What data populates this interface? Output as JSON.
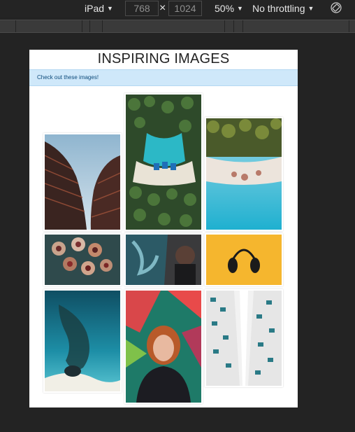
{
  "devtools": {
    "device": "iPad",
    "width": "768",
    "height": "1024",
    "separator": "×",
    "zoom": "50%",
    "throttling": "No throttling",
    "icons": {
      "rotate": "rotate-icon",
      "dropdown": "chevron-down-icon"
    }
  },
  "page": {
    "title": "INSPIRING IMAGES",
    "alert": "Check out these images!",
    "alert_color": "#cfe8fa"
  },
  "gallery": {
    "images": [
      {
        "subject": "curved-building-photo"
      },
      {
        "subject": "aerial-palm-beach-photo"
      },
      {
        "subject": "palm-shoreline-photo"
      },
      {
        "subject": "cupcakes-photo"
      },
      {
        "subject": "graffiti-wall-photo"
      },
      {
        "subject": "headphones-photo"
      },
      {
        "subject": "aerial-reef-photo"
      },
      {
        "subject": "portrait-mural-photo"
      },
      {
        "subject": "building-perspective-photo"
      }
    ]
  }
}
